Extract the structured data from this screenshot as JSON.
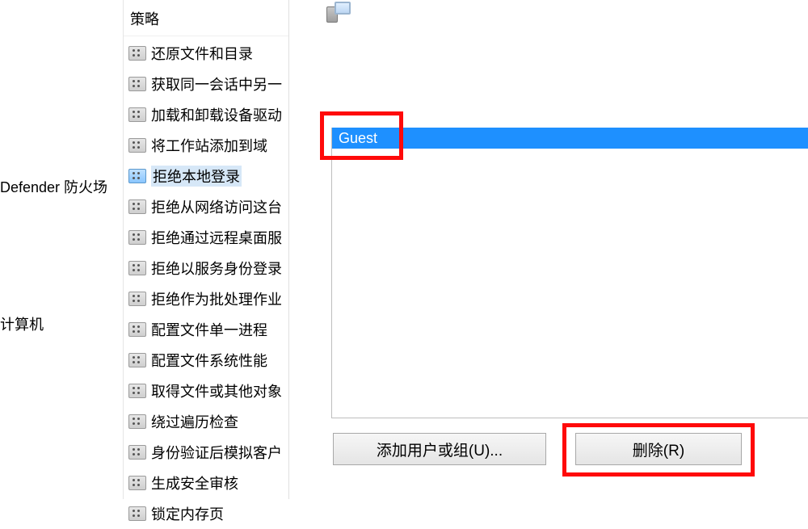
{
  "tree": {
    "defender": "Defender 防火场",
    "computer": "计算机"
  },
  "policyColumn": {
    "header": "策略",
    "selectedIndex": 4,
    "items": [
      "还原文件和目录",
      "获取同一会话中另一",
      "加载和卸载设备驱动",
      "将工作站添加到域",
      "拒绝本地登录",
      "拒绝从网络访问这台",
      "拒绝通过远程桌面服",
      "拒绝以服务身份登录",
      "拒绝作为批处理作业",
      "配置文件单一进程",
      "配置文件系统性能",
      "取得文件或其他对象",
      "绕过遍历检查",
      "身份验证后模拟客户",
      "生成安全审核",
      "锁定内存页"
    ]
  },
  "dialog": {
    "list": {
      "selected": "Guest"
    },
    "buttons": {
      "addUserGroup": "添加用户或组(U)...",
      "remove": "删除(R)"
    }
  }
}
